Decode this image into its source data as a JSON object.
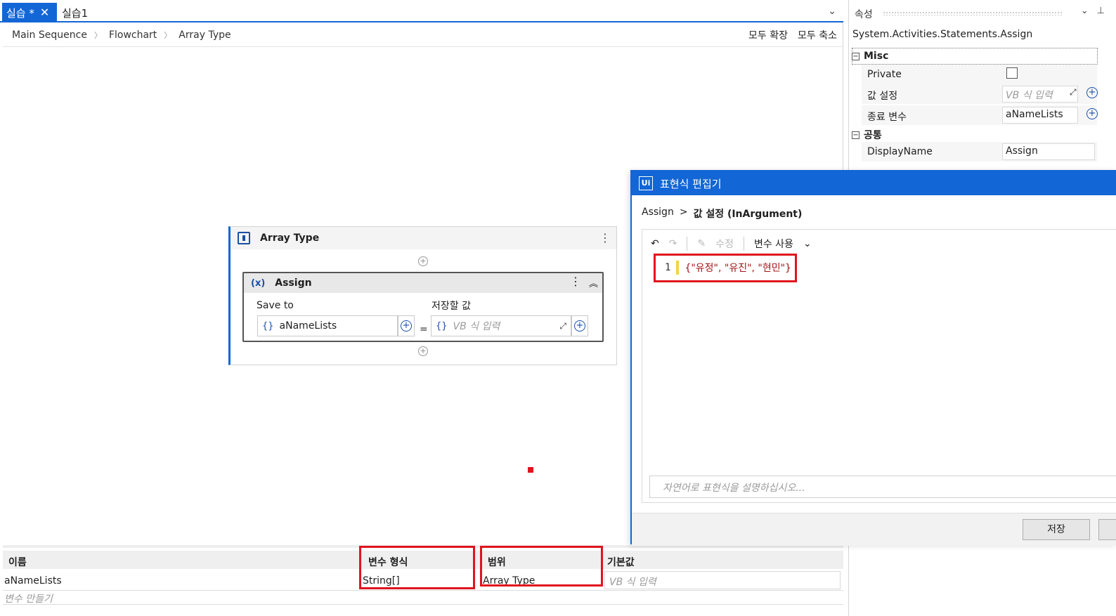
{
  "tabs": {
    "active": "실습 *",
    "inactive": "실습1"
  },
  "breadcrumb": [
    "Main Sequence",
    "Flowchart",
    "Array Type"
  ],
  "toolbar": {
    "expand_all": "모두 확장",
    "collapse_all": "모두 축소"
  },
  "sequence": {
    "title": "Array Type"
  },
  "assign": {
    "title": "Assign",
    "icon_text": "(x)",
    "save_to_label": "Save to",
    "value_label": "저장할 값",
    "save_to_value": "aNameLists",
    "value_placeholder": "VB 식 입력",
    "equals": "="
  },
  "variables": {
    "headers": [
      "이름",
      "변수 형식",
      "범위",
      "기본값"
    ],
    "rows": [
      {
        "name": "aNameLists",
        "type": "String[]",
        "scope": "Array Type",
        "default_placeholder": "VB 식 입력"
      }
    ],
    "create_placeholder": "변수 만들기"
  },
  "properties": {
    "title": "속성",
    "type_name": "System.Activities.Statements.Assign",
    "categories": {
      "misc": "Misc",
      "common": "공통"
    },
    "rows": {
      "private_label": "Private",
      "value_label": "값 설정",
      "value_placeholder": "VB 식 입력",
      "to_label": "종료 변수",
      "to_value": "aNameLists",
      "display_label": "DisplayName",
      "display_value": "Assign"
    }
  },
  "dialog": {
    "title": "표현식 편집기",
    "logo": "Ui",
    "crumb_parent": "Assign",
    "crumb_sep": ">",
    "crumb_current": "값 설정 (InArgument)",
    "toolbar_fix": "수정",
    "toolbar_use_var": "변수 사용",
    "line_number": "1",
    "code": "{\"유정\", \"유진\", \"현민\"}",
    "nl_placeholder": "자연어로 표현식을 설명하십시오...",
    "save": "저장"
  },
  "colors": {
    "accent": "#1266d6",
    "highlight": "#e0141e",
    "string_literal": "#a31515"
  }
}
